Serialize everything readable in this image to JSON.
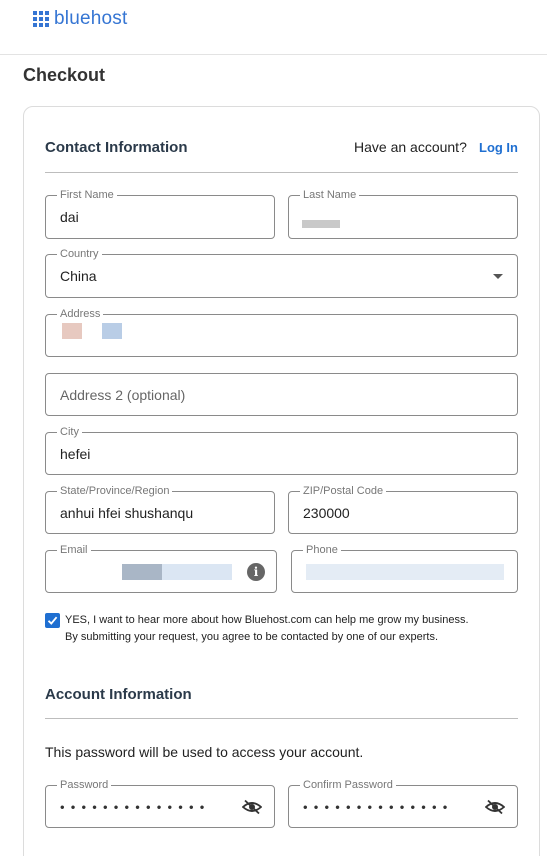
{
  "header": {
    "logo_text": "bluehost"
  },
  "page": {
    "title": "Checkout"
  },
  "contact": {
    "section_title": "Contact Information",
    "have_account_text": "Have an account?",
    "login_label": "Log In",
    "first_name": {
      "label": "First Name",
      "value": "dai"
    },
    "last_name": {
      "label": "Last Name",
      "value": ""
    },
    "country": {
      "label": "Country",
      "value": "China"
    },
    "address": {
      "label": "Address",
      "value": ""
    },
    "address2": {
      "placeholder": "Address 2 (optional)"
    },
    "city": {
      "label": "City",
      "value": "hefei"
    },
    "state": {
      "label": "State/Province/Region",
      "value": "anhui hfei shushanqu"
    },
    "zip": {
      "label": "ZIP/Postal Code",
      "value": "230000"
    },
    "email": {
      "label": "Email",
      "value": ""
    },
    "phone": {
      "label": "Phone",
      "value": ""
    },
    "consent_checked": true,
    "consent_line1": "YES, I want to hear more about how Bluehost.com can help me grow my business.",
    "consent_line2": "By submitting your request, you agree to be contacted by one of our experts."
  },
  "account": {
    "section_title": "Account Information",
    "note": "This password will be used to access your account.",
    "password": {
      "label": "Password",
      "masked": "••••••••••••••"
    },
    "confirm_password": {
      "label": "Confirm Password",
      "masked": "••••••••••••••"
    }
  },
  "colors": {
    "brand": "#3575d3",
    "link": "#1f6fd1",
    "checkbox": "#1f6fd1"
  }
}
